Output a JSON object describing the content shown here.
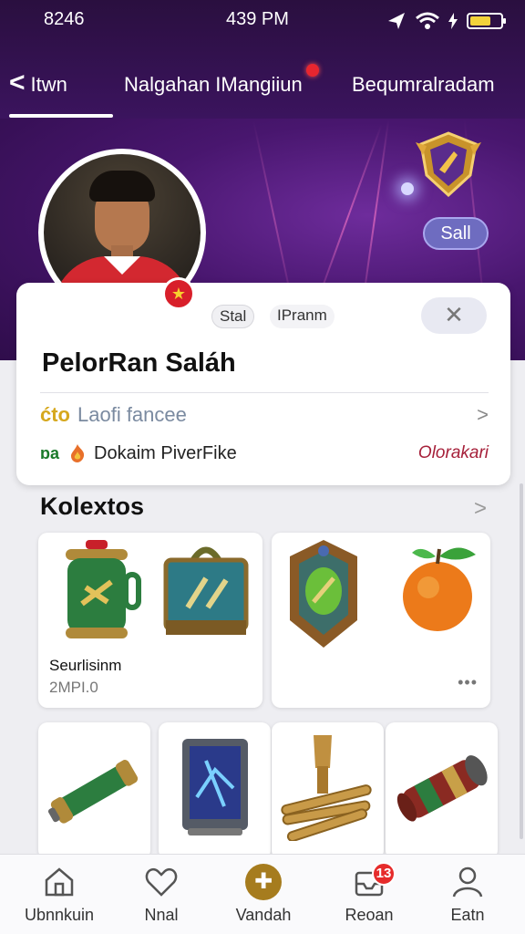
{
  "status_bar": {
    "left": "8246",
    "time": "439 PM",
    "battery_level": 0.7
  },
  "tabs": [
    {
      "label": "Itwn",
      "active": true
    },
    {
      "label": "Nalgahan IMangiiun",
      "has_notification": true
    },
    {
      "label": "Bequmralradam"
    }
  ],
  "hero": {
    "rank_pill": "Sall"
  },
  "profile": {
    "chip1": "Stal",
    "chip2": "IPranm",
    "close": "✕",
    "name": "PelorRan Saláh",
    "row1": {
      "prefix": "ćto",
      "text": "Laofi fancee"
    },
    "row2": {
      "prefix": "ɒa",
      "text": "Dokaim PiverFike",
      "link": "Olorakari"
    }
  },
  "collections": {
    "title": "Kolextos",
    "featured_label": "Seurlisinm",
    "featured_sub": "2MPI.0",
    "more_dots": "•••"
  },
  "bottom_nav": [
    {
      "label": "Ubnnkuin",
      "icon": "home-icon"
    },
    {
      "label": "Nnal",
      "icon": "heart-icon"
    },
    {
      "label": "Vandah",
      "icon": "plus-icon"
    },
    {
      "label": "Reoan",
      "icon": "inbox-icon",
      "badge": "13"
    },
    {
      "label": "Eatn",
      "icon": "user-icon"
    }
  ],
  "colors": {
    "header_purple": "#3c1460",
    "accent_gold": "#a67c1e",
    "badge_red": "#e62b2b"
  }
}
